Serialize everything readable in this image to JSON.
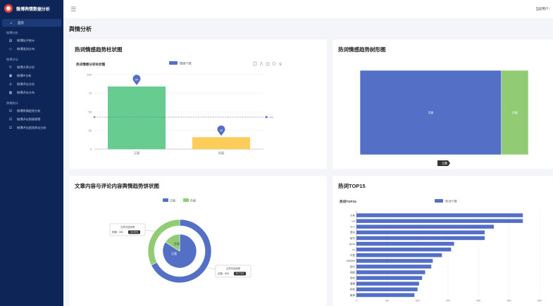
{
  "app": {
    "title": "微博舆情数据分析",
    "user_label": "当前用户："
  },
  "sidebar": {
    "active": {
      "label": "首页",
      "icon": "home-icon"
    },
    "groups": [
      {
        "title": "微博分析",
        "items": [
          {
            "label": "微博帖子统计",
            "icon": "doc-icon"
          },
          {
            "label": "微博类别分布",
            "icon": "tag-icon"
          }
        ]
      },
      {
        "title": "微博评论",
        "items": [
          {
            "label": "微博文章分析",
            "icon": "refresh-icon"
          },
          {
            "label": "微博IP分析",
            "icon": "map-icon"
          },
          {
            "label": "微博评论分析",
            "icon": "user-icon"
          },
          {
            "label": "微博评论分布",
            "icon": "chart-icon"
          }
        ]
      },
      {
        "title": "舆情统计",
        "items": [
          {
            "label": "微博舆情趋势分析",
            "icon": "check-icon"
          },
          {
            "label": "微博评论舆情预警",
            "icon": "check-icon"
          },
          {
            "label": "微博评论趋势舆论分析",
            "icon": "check-icon"
          }
        ]
      }
    ]
  },
  "page": {
    "title": "舆情分析"
  },
  "cards": {
    "bar": {
      "title": "热词情感趋势柱状图",
      "subtitle": "热词情感分析柱状图",
      "legend": "情感个数"
    },
    "treemap": {
      "title": "热词情感趋势树形图",
      "crumb": "主题"
    },
    "pie": {
      "title": "文章内容与评论内容舆情趋势饼状图"
    },
    "top": {
      "title": "热词TOP15",
      "subtitle": "热词TOP15",
      "legend": "热词个数"
    }
  },
  "chart_data": [
    {
      "type": "bar",
      "categories": [
        "正面",
        "负面"
      ],
      "values": [
        84,
        16
      ],
      "ylim": [
        0,
        100
      ],
      "yticks": [
        0,
        25,
        50,
        75,
        100
      ],
      "markline_label": "43",
      "colors": [
        "#67cc8f",
        "#fdcd5a"
      ],
      "pin_labels": [
        "84",
        "16"
      ]
    },
    {
      "type": "treemap",
      "items": [
        {
          "name": "正面",
          "value": 84,
          "color": "#5470c6"
        },
        {
          "name": "负面",
          "value": 16,
          "color": "#91cc75"
        }
      ]
    },
    {
      "type": "pie",
      "legend": [
        "正面",
        "负面"
      ],
      "colors": [
        "#5470c6",
        "#91cc75"
      ],
      "outer": {
        "name": "文章内容舆情",
        "values": {
          "正面": 694,
          "负面": 331
        },
        "tooltip_pct": "67.71%"
      },
      "inner": {
        "values": {
          "正面": 84,
          "负面": 16
        }
      },
      "tooltip_top": {
        "title": "文章内容舆情",
        "label": "负面：331",
        "pct": "32.29%"
      },
      "tooltip_bottom": {
        "title": "文章内容舆情",
        "label": "正面：694",
        "pct": "67.71%"
      }
    },
    {
      "type": "bar",
      "orientation": "horizontal",
      "categories": [
        "头条",
        "cut",
        "hy-e",
        "黑料",
        "都市",
        "good",
        "ny",
        "可爱",
        "MMMM",
        "新时",
        "视频",
        "哈哈",
        "爱情",
        "相信",
        "微博"
      ],
      "values": [
        545,
        545,
        450,
        420,
        420,
        320,
        310,
        280,
        250,
        245,
        225,
        215,
        205,
        200,
        190
      ],
      "xlim": [
        0,
        600
      ],
      "xticks": [
        0,
        100,
        200,
        300,
        400,
        500,
        600
      ],
      "color": "#5470c6"
    }
  ]
}
